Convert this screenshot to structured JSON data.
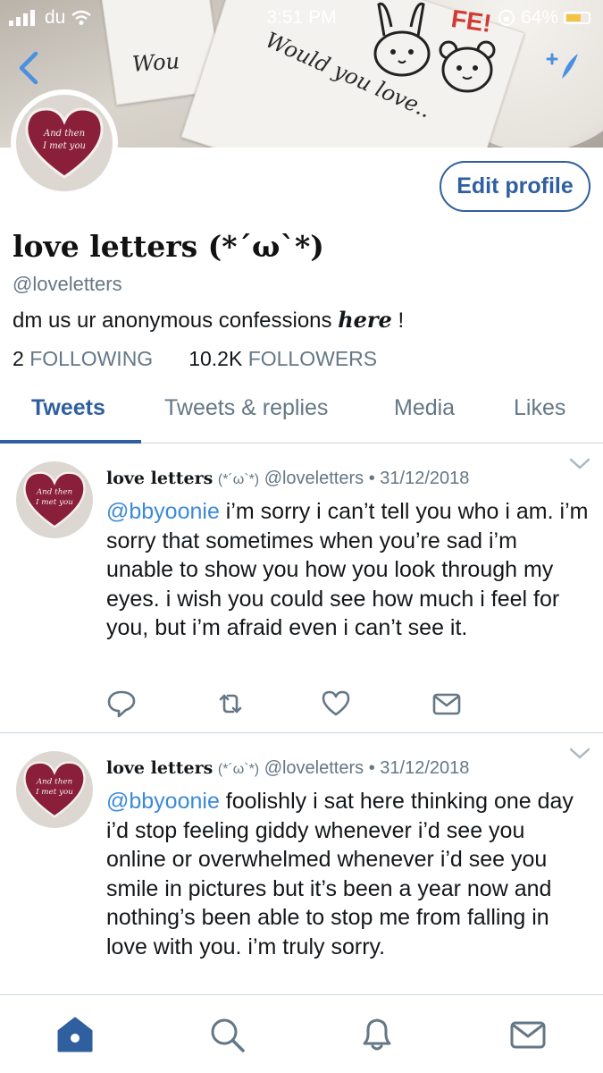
{
  "status_bar": {
    "carrier": "du",
    "time": "3:51 PM",
    "battery": "64%"
  },
  "banner": {
    "card_text_1": "Wou",
    "card_text_2": "Would you love..",
    "stamp": "FE!"
  },
  "profile": {
    "name": "love letters (*´ω`*)",
    "handle": "@loveletters",
    "bio_prefix": "dm us ur anonymous confessions ",
    "bio_emphasis": "here",
    "bio_suffix": " !",
    "following_count": "2",
    "following_label": "FOLLOWING",
    "followers_count": "10.2K",
    "followers_label": "FOLLOWERS",
    "edit_label": "Edit profile",
    "avatar_text_1": "And then",
    "avatar_text_2": "I met you"
  },
  "tabs": [
    {
      "label": "Tweets",
      "active": true
    },
    {
      "label": "Tweets & replies",
      "active": false
    },
    {
      "label": "Media",
      "active": false
    },
    {
      "label": "Likes",
      "active": false
    }
  ],
  "tweets": [
    {
      "name": "love letters",
      "kaomoji": "(*´ω`*)",
      "handle": "@loveletters",
      "date": "31/12/2018",
      "mention": "@bbyoonie",
      "text": " i’m sorry i can’t tell you who i am. i’m sorry that sometimes when you’re sad i’m unable to show you how you look through my eyes. i wish you could see how much i feel for you, but i’m afraid even i can’t see it."
    },
    {
      "name": "love letters",
      "kaomoji": "(*´ω`*)",
      "handle": "@loveletters",
      "date": "31/12/2018",
      "mention": "@bbyoonie",
      "text": " foolishly i sat here thinking one day i’d stop feeling giddy whenever i’d see you online or overwhelmed whenever i’d see you smile in pictures but it’s been a year now and nothing’s been able to stop me from falling in love with you. i’m truly sorry."
    }
  ],
  "colors": {
    "accent": "#2f5f9e",
    "mention": "#3b8ad9",
    "secondary_text": "#657786",
    "avatar_heart": "#8a1f3a"
  },
  "icons": [
    "back-icon",
    "add-user-icon",
    "chevron-down-icon",
    "reply-icon",
    "retweet-icon",
    "like-icon",
    "share-message-icon",
    "home-icon",
    "search-icon",
    "notifications-icon",
    "messages-icon"
  ]
}
